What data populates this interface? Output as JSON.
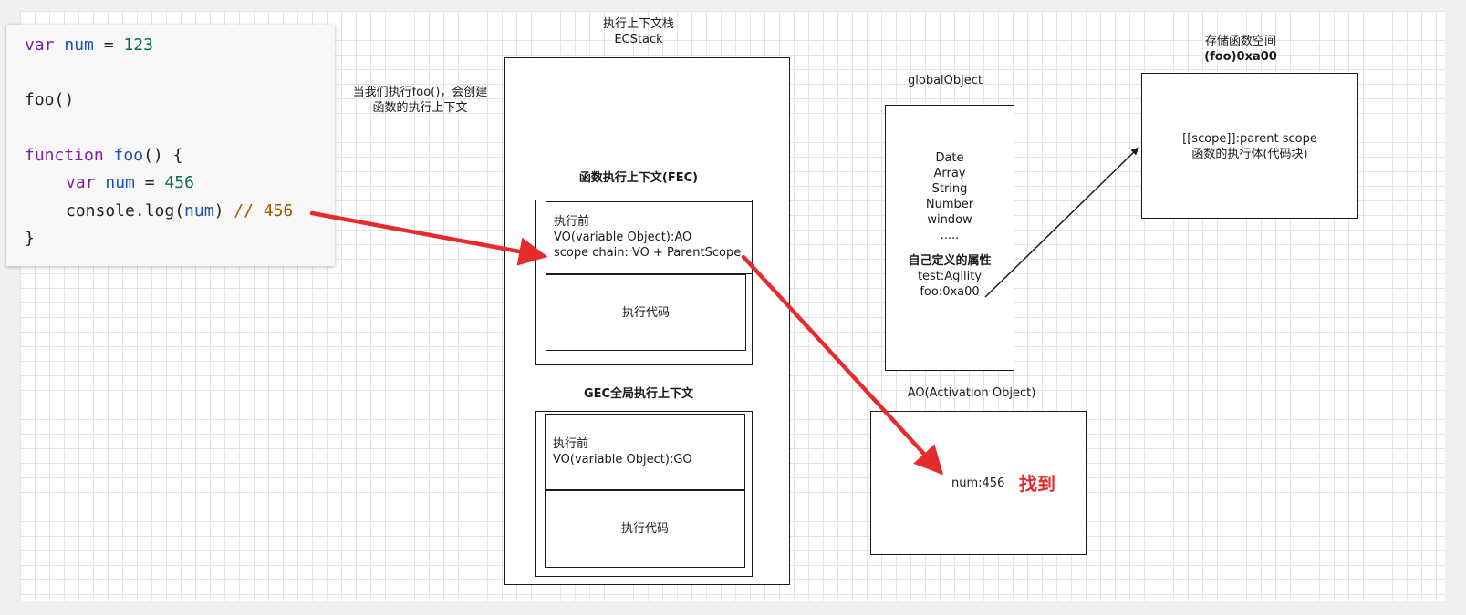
{
  "code": {
    "line1": {
      "kw": "var",
      "name": "num",
      "op": " = ",
      "value": "123"
    },
    "line2": {
      "call": "foo()"
    },
    "line3": {
      "kw": "function",
      "name": "foo",
      "rest": "() {"
    },
    "line4": {
      "kw": "var",
      "name": "num",
      "op": " = ",
      "value": "456"
    },
    "line5": {
      "obj": "console.log(",
      "arg": "num",
      "close": ")",
      "comment": "// 456"
    },
    "line6": {
      "text": "}"
    }
  },
  "note": {
    "line1": "当我们执行foo()，会创建",
    "line2": "函数的执行上下文"
  },
  "ecstack": {
    "title1": "执行上下文栈",
    "title2": "ECStack"
  },
  "fec": {
    "title": "函数执行上下文(FEC)",
    "pre_label": "执行前",
    "vo": "VO(variable Object):AO",
    "scope_chain": "scope chain: VO + ParentScope",
    "exec_code": "执行代码"
  },
  "gec": {
    "title": "GEC全局执行上下文",
    "pre_label": "执行前",
    "vo": "VO(variable Object):GO",
    "exec_code": "执行代码"
  },
  "global_object": {
    "title": "globalObject",
    "items": [
      "Date",
      "Array",
      "String",
      "Number",
      "window",
      "....."
    ],
    "custom_title": "自己定义的属性",
    "custom_items": [
      "test:Agility",
      "foo:0xa00"
    ]
  },
  "func_storage": {
    "title1": "存储函数空间",
    "title2": "(foo)0xa00",
    "line1": "[[scope]]:parent scope",
    "line2": "函数的执行体(代码块)"
  },
  "ao": {
    "title": "AO(Activation Object)",
    "value": "num:456",
    "found": "找到"
  },
  "colors": {
    "arrow_red": "#e52b2b",
    "arrow_dark": "#1a1a1a"
  }
}
